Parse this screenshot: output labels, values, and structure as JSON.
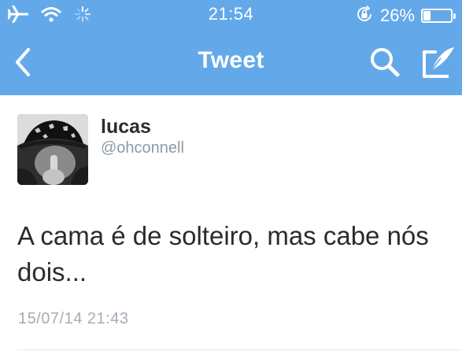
{
  "status_bar": {
    "time": "21:54",
    "battery_percent": "26%",
    "battery_level": 0.26,
    "icons": [
      "airplane-icon",
      "wifi-icon",
      "activity-spinner-icon",
      "rotation-lock-icon",
      "battery-icon"
    ]
  },
  "nav": {
    "title": "Tweet",
    "icons": [
      "back-chevron-icon",
      "search-icon",
      "compose-icon"
    ]
  },
  "tweet": {
    "user_name": "lucas",
    "user_handle": "@ohconnell",
    "text": "A cama é de solteiro, mas cabe nós dois...",
    "timestamp": "15/07/14 21:43"
  },
  "colors": {
    "header_blue": "#63a9ea",
    "text_dark": "#2b2b2b",
    "text_muted": "#8e9aa6"
  }
}
